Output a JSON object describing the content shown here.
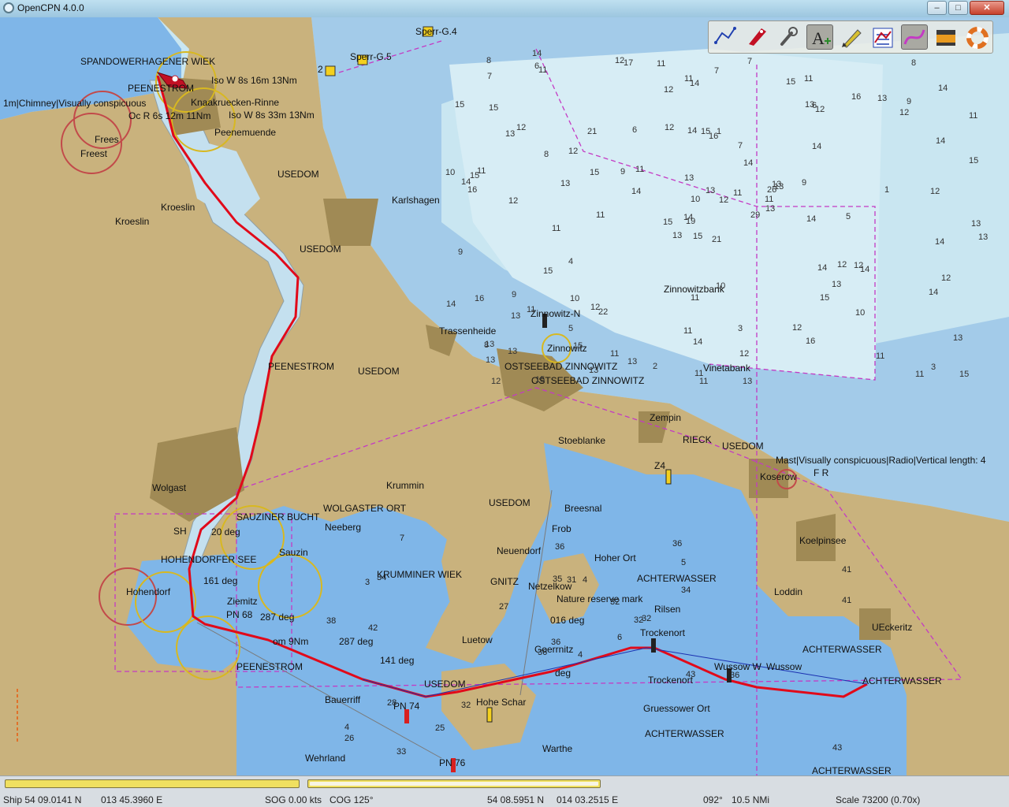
{
  "window": {
    "title": "OpenCPN 4.0.0",
    "min_label": "–",
    "max_label": "□",
    "close_label": "✕"
  },
  "toolbar": {
    "buttons": [
      {
        "name": "route-tool-icon",
        "active": false
      },
      {
        "name": "boat-track-icon",
        "active": false
      },
      {
        "name": "settings-wrench-icon",
        "active": false
      },
      {
        "name": "text-icon",
        "active": true
      },
      {
        "name": "pencil-icon",
        "active": false
      },
      {
        "name": "chart-list-icon",
        "active": false
      },
      {
        "name": "track-icon",
        "active": true
      },
      {
        "name": "color-scheme-icon",
        "active": false
      },
      {
        "name": "life-ring-icon",
        "active": false
      }
    ]
  },
  "map": {
    "colors": {
      "land": "#c9b27d",
      "built_up": "#a08a55",
      "shallow_water": "#7fb6e8",
      "medium_water": "#a3cbe9",
      "deep_water": "#c9e6f1",
      "route": "#e10a1a",
      "boundary": "#c43ac4"
    },
    "labels": {
      "spandower": "SPANDOWERHAGENER WIEK",
      "peenestrom_n": "PEENESTROM",
      "iso_1": "Iso W 8s 16m 13Nm",
      "knaak": "Knaakruecken-Rinne",
      "iso_2": "Iso W 8s 33m 13Nm",
      "chimney": "1m|Chimney|Visually conspicuous",
      "oc_r": "Oc R 6s 12m 11Nm",
      "peenemuende": "Peenemuende",
      "freest_1": "Frees",
      "freest_2": "Freest",
      "usedom_1": "USEDOM",
      "kroeslin": "Kroeslin",
      "kroeslin_2": "Kroeslin",
      "usedom_2": "USEDOM",
      "karlshagen": "Karlshagen",
      "sperr_g4": "Sperr-G.4",
      "sperr_g5": "Sperr-G.5",
      "z2": "2",
      "zinnowitzbank": "Zinnowitzbank",
      "trassenheide": "Trassenheide",
      "zinnowitz_n": "Zinnowitz-N",
      "zinnowitz": "Zinnowitz",
      "ostseebad_1": "OSTSEEBAD ZINNOWITZ",
      "ostseebad_2": "OSTSEEBAD ZINNOWITZ",
      "vinetabank": "Vinetabank",
      "peenestrom_c": "PEENESTROM",
      "usedom_3": "USEDOM",
      "stoeblanke": "Stoeblanke",
      "zempin": "Zempin",
      "rieck": "RIECK",
      "usedom_4": "USEDOM",
      "mast": "Mast|Visually conspicuous|Radio|Vertical length: 4",
      "f_r": "F R",
      "koserow": "Koserow",
      "z4": "Z4",
      "wolgast": "Wolgast",
      "krummin": "Krummin",
      "wolgaster_ort": "WOLGASTER ORT",
      "usedom_5": "USEDOM",
      "sauziner_bucht": "SAUZINER BUCHT",
      "neeberg": "Neeberg",
      "breesnal": "Breesnal",
      "frob": "Frob",
      "neuendorf": "Neuendorf",
      "koelpinsee": "Koelpinsee",
      "sh": "SH",
      "deg_20": "20 deg",
      "hohendorfer": "HOHENDORFER SEE",
      "sauzin": "Sauzin",
      "krumminer_wiek": "KRUMMINER WIEK",
      "gnitz": "GNITZ",
      "netzelkow": "Netzelkow",
      "hoher_ort": "Hoher Ort",
      "achterwasser_1": "ACHTERWASSER",
      "deg_161": "161 deg",
      "hohendorf": "Hohendorf",
      "nature": "Nature reserve mark",
      "rilsen": "Rilsen",
      "loddin": "Loddin",
      "ziemitz": "Ziemitz",
      "pn68": "PN 68",
      "deg_287": "287 deg",
      "deg_016": "016 deg",
      "trockenort_1": "Trockenort",
      "ueckeritz": "UEckeritz",
      "nm9": "om 9Nm",
      "deg_287b": "287 deg",
      "luetow": "Luetow",
      "achterwasser_2": "ACHTERWASSER",
      "peenestrom_s": "PEENESTROM",
      "deg_141": "141 deg",
      "goerrnitz": "Goerrnitz",
      "deg_b": "deg",
      "usedom_6": "USEDOM",
      "trockenort_2": "Trockenort",
      "wussow_1": "Wussow W",
      "wussow_2": "Wussow",
      "achterwasser_3": "ACHTERWASSER",
      "bauerriff": "Bauerriff",
      "pn74": "PN 74",
      "hohe_schar": "Hohe Schar",
      "gruessower": "Gruessower Ort",
      "achterwasser_4": "ACHTERWASSER",
      "warthe": "Warthe",
      "wehrland": "Wehrland",
      "pn76": "PN 76",
      "achterwasser_5": "ACHTERWASSER"
    },
    "soundings": [
      "21",
      "13",
      "19",
      "13",
      "26",
      "22",
      "11",
      "1",
      "6",
      "29",
      "11",
      "15",
      "12",
      "11",
      "13",
      "14",
      "15",
      "14",
      "14",
      "11",
      "11",
      "13",
      "15",
      "15",
      "13",
      "14",
      "12",
      "14",
      "16",
      "14",
      "15",
      "14",
      "11",
      "10",
      "21",
      "16",
      "12",
      "11",
      "13",
      "12",
      "7",
      "9",
      "13",
      "15",
      "13",
      "10",
      "11",
      "12",
      "14",
      "13",
      "13",
      "14",
      "15",
      "13",
      "16",
      "5",
      "6",
      "8",
      "3",
      "9",
      "7",
      "11",
      "11",
      "12",
      "13",
      "14",
      "15",
      "12",
      "13",
      "14",
      "11",
      "13",
      "12",
      "15",
      "8",
      "7",
      "8",
      "9",
      "13",
      "12",
      "11",
      "13",
      "14",
      "12",
      "11",
      "12",
      "10",
      "11",
      "13",
      "12",
      "11",
      "13",
      "9",
      "10",
      "12",
      "14",
      "15",
      "11",
      "13",
      "12",
      "11",
      "12",
      "13",
      "14",
      "15",
      "10",
      "11",
      "13",
      "12",
      "14",
      "14",
      "15",
      "16",
      "15",
      "17",
      "16",
      "15",
      "14",
      "12",
      "11",
      "9",
      "8",
      "7",
      "6",
      "5",
      "4",
      "3",
      "2",
      "1"
    ],
    "deep_soundings": [
      "4",
      "3",
      "36",
      "4",
      "32",
      "32",
      "36",
      "4",
      "5",
      "6",
      "7",
      "43",
      "42",
      "41",
      "36",
      "34",
      "33",
      "35",
      "32",
      "28",
      "27",
      "26",
      "25",
      "31",
      "32",
      "36",
      "34",
      "36",
      "38",
      "43",
      "41"
    ]
  },
  "status": {
    "ship_pos": "Ship 54 09.0141 N",
    "ship_lon": "013 45.3960 E",
    "sog": "SOG 0.00 kts",
    "cog": "COG 125°",
    "cursor_lat": "54 08.5951 N",
    "cursor_lon": "014 03.2515 E",
    "brg": "092°",
    "dist": "10.5 NMi",
    "scale": "Scale 73200 (0.70x)",
    "progress_left_fraction": 1.0,
    "progress_right_fraction": 0.99
  }
}
